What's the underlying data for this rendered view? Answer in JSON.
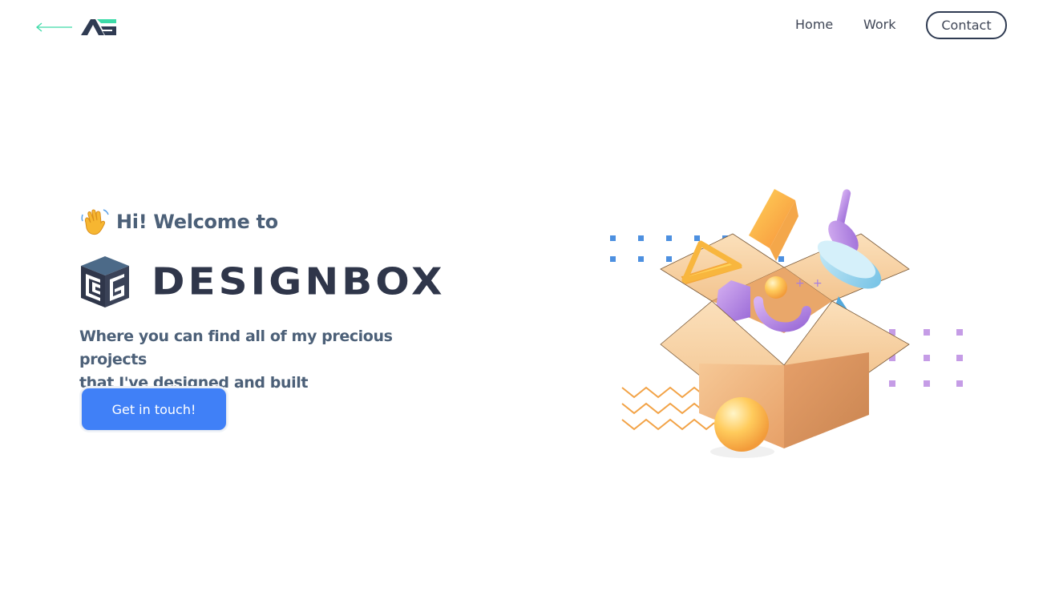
{
  "nav": {
    "home_label": "Home",
    "work_label": "Work",
    "contact_label": "Contact"
  },
  "hero": {
    "greeting": "Hi! Welcome to",
    "brand": "DESIGNBOX",
    "tagline_line1": "Where you can find all of my precious projects",
    "tagline_line2": "that I've designed and built",
    "cta_label": "Get in touch!"
  },
  "icons": {
    "back": "arrow-left-icon",
    "logo": "ag-logo",
    "wave": "waving-hand-icon",
    "brand": "cube-logo-icon",
    "illustration": "open-box-illustration"
  },
  "colors": {
    "accent": "#4080f7",
    "back_arrow": "#3ddba8",
    "text_dark": "#2f364a",
    "text_muted": "#4c6078"
  }
}
